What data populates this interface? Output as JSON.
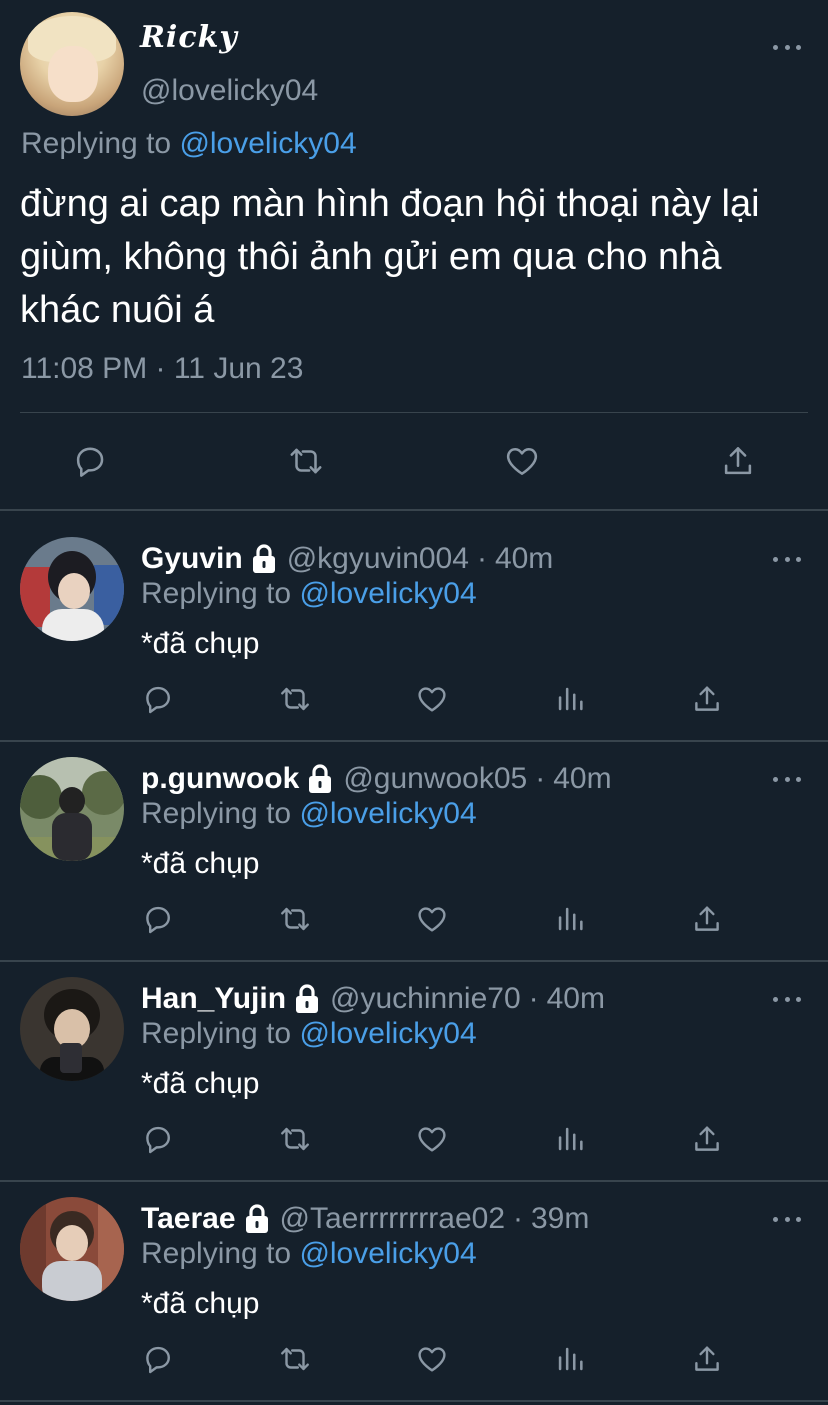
{
  "main_tweet": {
    "display_name": "Ricky",
    "handle": "@lovelicky04",
    "replying_prefix": "Replying to",
    "replying_to": "@lovelicky04",
    "text": "đừng ai cap màn hình đoạn hội thoại này lại giùm, không thôi ảnh gửi em qua cho nhà khác nuôi á",
    "timestamp": "11:08 PM · 11 Jun 23",
    "actions": [
      "reply-icon",
      "retweet-icon",
      "like-icon",
      "share-icon"
    ]
  },
  "replies": [
    {
      "name": "Gyuvin",
      "handle": "@kgyuvin004",
      "separator": "·",
      "time": "40m",
      "replying_prefix": "Replying to",
      "replying_to": "@lovelicky04",
      "text": "*đã chụp",
      "protected": true
    },
    {
      "name": "p.gunwook",
      "handle": "@gunwook05",
      "separator": "·",
      "time": "40m",
      "replying_prefix": "Replying to",
      "replying_to": "@lovelicky04",
      "text": "*đã chụp",
      "protected": true
    },
    {
      "name": "Han_Yujin",
      "handle": "@yuchinnie70",
      "separator": "·",
      "time": "40m",
      "replying_prefix": "Replying to",
      "replying_to": "@lovelicky04",
      "text": "*đã chụp",
      "protected": true
    },
    {
      "name": "Taerae",
      "handle": "@Taerrrrrrrrae02",
      "separator": "·",
      "time": "39m",
      "replying_prefix": "Replying to",
      "replying_to": "@lovelicky04",
      "text": "*đã chụp",
      "protected": true
    }
  ],
  "reply_actions": [
    "reply-icon",
    "retweet-icon",
    "like-icon",
    "analytics-icon",
    "share-icon"
  ],
  "colors": {
    "background": "#15202b",
    "secondary_text": "#8b98a5",
    "mention": "#4a9fe8",
    "divider": "#38444d"
  }
}
